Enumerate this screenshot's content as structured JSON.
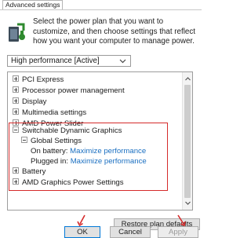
{
  "tab": {
    "label": "Advanced settings"
  },
  "intro": {
    "text": "Select the power plan that you want to customize, and then choose settings that reflect how you want your computer to manage power."
  },
  "plan_select": {
    "value": "High performance [Active]"
  },
  "tree": {
    "items": [
      {
        "label": "PCI Express",
        "expander": "plus"
      },
      {
        "label": "Processor power management",
        "expander": "plus"
      },
      {
        "label": "Display",
        "expander": "plus"
      },
      {
        "label": "Multimedia settings",
        "expander": "plus"
      },
      {
        "label": "AMD Power Slider",
        "expander": "plus"
      },
      {
        "label": "Switchable Dynamic Graphics",
        "expander": "minus"
      },
      {
        "label": "Global Settings",
        "expander": "minus"
      },
      {
        "label": "On battery:",
        "value": "Maximize performance"
      },
      {
        "label": "Plugged in:",
        "value": "Maximize performance"
      },
      {
        "label": "Battery",
        "expander": "plus"
      },
      {
        "label": "AMD Graphics Power Settings",
        "expander": "plus"
      }
    ]
  },
  "buttons": {
    "restore": "Restore plan defaults",
    "ok": "OK",
    "cancel": "Cancel",
    "apply": "Apply"
  },
  "colors": {
    "highlight": "#d52b2b",
    "link": "#1a6fc1"
  }
}
